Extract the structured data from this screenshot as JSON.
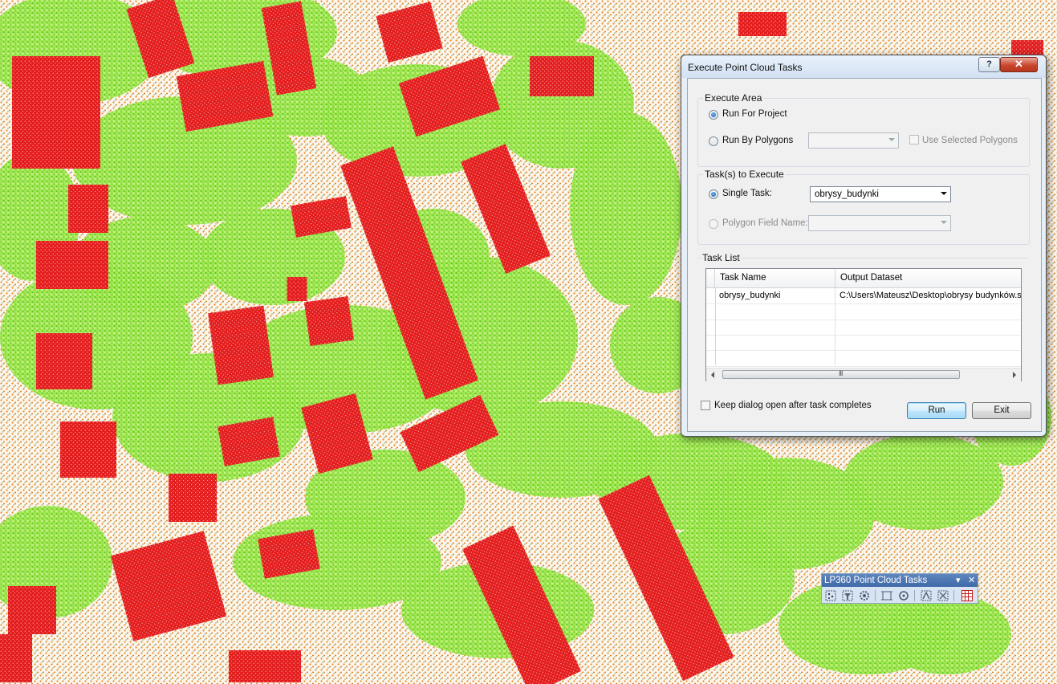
{
  "dialog": {
    "title": "Execute Point Cloud Tasks",
    "help_button": "?",
    "close_button": "✕",
    "execute_area": {
      "label": "Execute Area",
      "run_for_project": "Run For Project",
      "run_by_polygons": "Run By Polygons",
      "run_by_polygons_value": "",
      "use_selected_polygons": "Use Selected Polygons",
      "selected_option": "run_for_project"
    },
    "tasks_to_execute": {
      "label": "Task(s) to Execute",
      "single_task": "Single Task:",
      "single_task_value": "obrysy_budynki",
      "polygon_field_name": "Polygon Field Name:",
      "polygon_field_value": ""
    },
    "task_list": {
      "label": "Task List",
      "columns": [
        "Task Name",
        "Output Dataset"
      ],
      "rows": [
        [
          "obrysy_budynki",
          "C:\\Users\\Mateusz\\Desktop\\obrysy budynków.shp"
        ],
        [
          "",
          ""
        ],
        [
          "",
          ""
        ],
        [
          "",
          ""
        ],
        [
          "",
          ""
        ]
      ],
      "scroll_grip": "III"
    },
    "keep_open": "Keep dialog open after task completes",
    "run_button": "Run",
    "exit_button": "Exit"
  },
  "toolbar": {
    "title": "LP360 Point Cloud Tasks",
    "dropdown": "▾",
    "close": "✕",
    "tools": [
      "classify-icon",
      "filter-icon",
      "settings-task-icon",
      "extract-icon",
      "detect-icon",
      "conflate-icon",
      "polygon-icon",
      "grid-icon"
    ]
  },
  "colors": {
    "building": "#e41e1e",
    "vegetation": "#8ce62c",
    "ground": "#e98a23",
    "background": "#fbf6ee",
    "accent": "#3c7fb1"
  }
}
